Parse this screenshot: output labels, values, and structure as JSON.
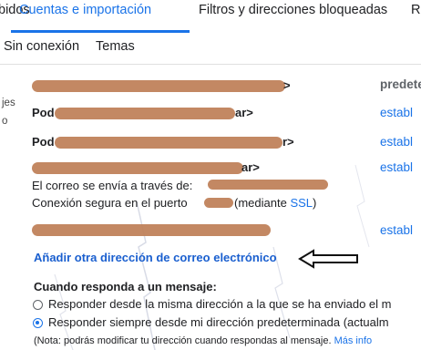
{
  "tabs": {
    "items": [
      {
        "label": "bidos"
      },
      {
        "label": "Cuentas e importación",
        "active": true
      },
      {
        "label": "Filtros y direcciones bloqueadas"
      },
      {
        "label": "Re"
      }
    ],
    "secondary": [
      {
        "label": "Sin conexión"
      },
      {
        "label": "Temas"
      }
    ]
  },
  "side": {
    "label1": "jes",
    "label2": "o"
  },
  "rows": {
    "row1_suffix": ">",
    "row1_right": "predete",
    "row2_prefix": "Pod",
    "row2_suffix": "ar>",
    "row2_right": "establ",
    "row3_prefix": "Pod",
    "row3_suffix": "r>",
    "row3_right": "establ",
    "row4_suffix": "ar>",
    "row4_right": "establ",
    "sent_via": "El correo se envía a través de:",
    "secure_prefix": "Conexión segura en el puerto",
    "secure_middle": "(mediante",
    "ssl": "SSL",
    "secure_end": ")",
    "row5_right": "establ"
  },
  "add_address": "Añadir otra dirección de correo electrónico",
  "reply": {
    "title": "Cuando responda a un mensaje:",
    "option1": "Responder desde la misma dirección a la que se ha enviado el m",
    "option2": "Responder siempre desde mi dirección predeterminada (actualm",
    "note": "(Nota: podrás modificar tu dirección cuando respondas al mensaje.",
    "more": "Más info"
  }
}
